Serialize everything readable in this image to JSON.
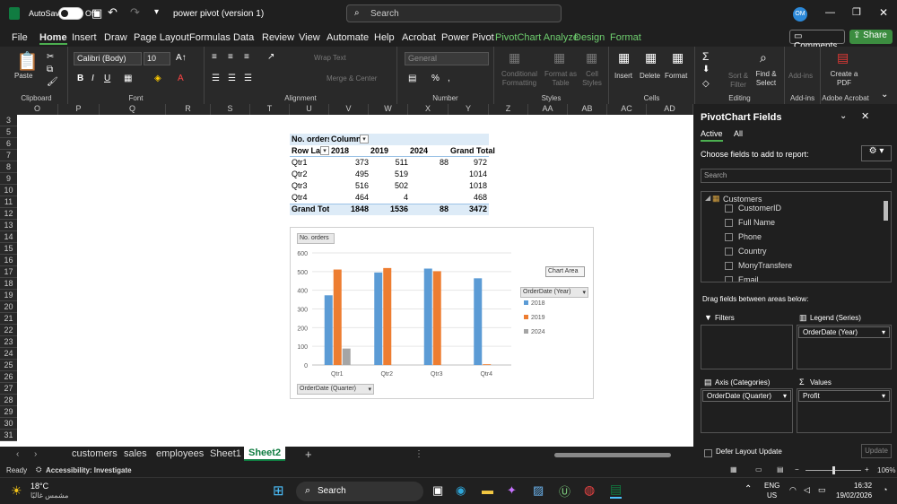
{
  "title": {
    "autosave": "AutoSave",
    "toggle": "Off",
    "doc": "power pivot (version 1)",
    "search": "Search",
    "avatar": "OM"
  },
  "menu": [
    "File",
    "Home",
    "Insert",
    "Draw",
    "Page Layout",
    "Formulas",
    "Data",
    "Review",
    "View",
    "Automate",
    "Help",
    "Acrobat",
    "Power Pivot",
    "PivotChart Analyze",
    "Design",
    "Format"
  ],
  "menu_right": {
    "comments": "Comments",
    "share": "Share"
  },
  "ribbon": {
    "paste": "Paste",
    "clipboard": "Clipboard",
    "font_name": "Calibri (Body)",
    "font_size": "10",
    "font": "Font",
    "wrap": "Wrap Text",
    "merge": "Merge & Center",
    "alignment": "Alignment",
    "number_format": "General",
    "number": "Number",
    "cond": "Conditional Formatting",
    "fmt_table": "Format as Table",
    "cell_styles": "Cell Styles",
    "styles": "Styles",
    "insert": "Insert",
    "delete": "Delete",
    "format": "Format",
    "cells": "Cells",
    "sort": "Sort & Filter",
    "find": "Find & Select",
    "editing": "Editing",
    "addins": "Add-ins",
    "addins_grp": "Add-ins",
    "pdf": "Create a PDF",
    "adobe": "Adobe Acrobat"
  },
  "columns": [
    "O",
    "P",
    "Q",
    "R",
    "S",
    "T",
    "U",
    "V",
    "W",
    "X",
    "Y",
    "Z",
    "AA",
    "AB",
    "AC",
    "AD"
  ],
  "rows": [
    "3",
    "5",
    "6",
    "7",
    "8",
    "9",
    "10",
    "11",
    "12",
    "13",
    "14",
    "15",
    "16",
    "17",
    "18",
    "19",
    "20",
    "21",
    "22",
    "23",
    "24",
    "25",
    "26",
    "27",
    "28",
    "29",
    "30",
    "31"
  ],
  "pivot": {
    "h1": "No. orders",
    "h2": "Column",
    "rowlab": "Row Lal",
    "y1": "2018",
    "y2": "2019",
    "y3": "2024",
    "gt": "Grand Total",
    "rows": [
      [
        "Qtr1",
        "373",
        "511",
        "88",
        "972"
      ],
      [
        "Qtr2",
        "495",
        "519",
        "",
        "1014"
      ],
      [
        "Qtr3",
        "516",
        "502",
        "",
        "1018"
      ],
      [
        "Qtr4",
        "464",
        "4",
        "",
        "468"
      ]
    ],
    "total": [
      "Grand Tota",
      "1848",
      "1536",
      "88",
      "3472"
    ]
  },
  "chart_data": {
    "type": "bar",
    "categories": [
      "Qtr1",
      "Qtr2",
      "Qtr3",
      "Qtr4"
    ],
    "series": [
      {
        "name": "2018",
        "values": [
          373,
          495,
          516,
          464
        ],
        "color": "#5b9bd5"
      },
      {
        "name": "2019",
        "values": [
          511,
          519,
          502,
          4
        ],
        "color": "#ed7d31"
      },
      {
        "name": "2024",
        "values": [
          88,
          0,
          0,
          0
        ],
        "color": "#a5a5a5"
      }
    ],
    "yticks": [
      "0",
      "100",
      "200",
      "300",
      "400",
      "500",
      "600"
    ],
    "ylim": [
      0,
      600
    ],
    "value_button": "No. orders",
    "legend_button": "OrderDate (Year)",
    "axis_button": "OrderDate (Quarter)",
    "tooltip": "Chart Area",
    "legend_pos": "right"
  },
  "pane": {
    "title": "PivotChart Fields",
    "tab_active": "Active",
    "tab_all": "All",
    "choose": "Choose fields to add to report:",
    "search": "Search",
    "table": "Customers",
    "fields": [
      "CustomerID",
      "Full Name",
      "Phone",
      "Country",
      "MonyTransfere",
      "Email"
    ],
    "drag": "Drag fields between areas below:",
    "filters": "Filters",
    "legend": "Legend (Series)",
    "legend_val": "OrderDate (Year)",
    "axis": "Axis (Categories)",
    "axis_val": "OrderDate (Quarter)",
    "values": "Values",
    "values_val": "Profit",
    "defer": "Defer Layout Update",
    "update": "Update"
  },
  "tabs": [
    "customers",
    "sales",
    "employees",
    "Sheet1",
    "Sheet2"
  ],
  "status": {
    "ready": "Ready",
    "access": "Accessibility: Investigate",
    "zoom": "106%"
  },
  "taskbar": {
    "temp": "18°C",
    "weather": "مشمس غالبًا",
    "search": "Search",
    "lang1": "ENG",
    "lang2": "US",
    "time": "16:32",
    "date": "19/02/2026"
  }
}
